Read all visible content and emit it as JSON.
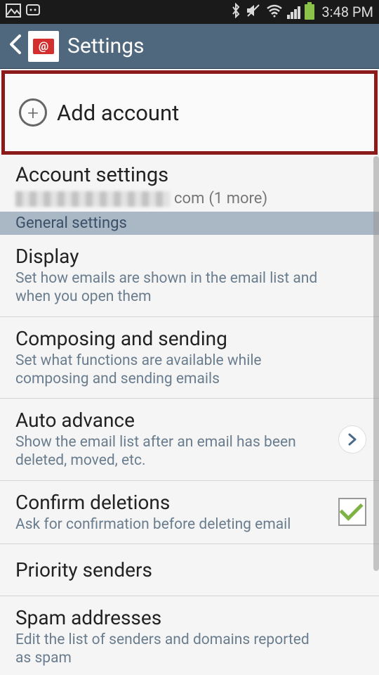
{
  "status": {
    "time": "3:48 PM"
  },
  "header": {
    "title": "Settings",
    "logo_glyph": "@"
  },
  "add_account": {
    "label": "Add account"
  },
  "account_settings": {
    "title": "Account settings",
    "domain_suffix": "com",
    "more": "(1 more)"
  },
  "section": {
    "general": "General settings"
  },
  "items": [
    {
      "title": "Display",
      "sub": "Set how emails are shown in the email list and when you open them",
      "accessory": "none"
    },
    {
      "title": "Composing and sending",
      "sub": "Set what functions are available while composing and sending emails",
      "accessory": "none"
    },
    {
      "title": "Auto advance",
      "sub": "Show the email list after an email has been deleted, moved, etc.",
      "accessory": "chevron"
    },
    {
      "title": "Confirm deletions",
      "sub": "Ask for confirmation before deleting email",
      "accessory": "checkbox",
      "checked": true
    },
    {
      "title": "Priority senders",
      "sub": "",
      "accessory": "none"
    },
    {
      "title": "Spam addresses",
      "sub": "Edit the list of senders and domains reported as spam",
      "accessory": "none"
    }
  ]
}
